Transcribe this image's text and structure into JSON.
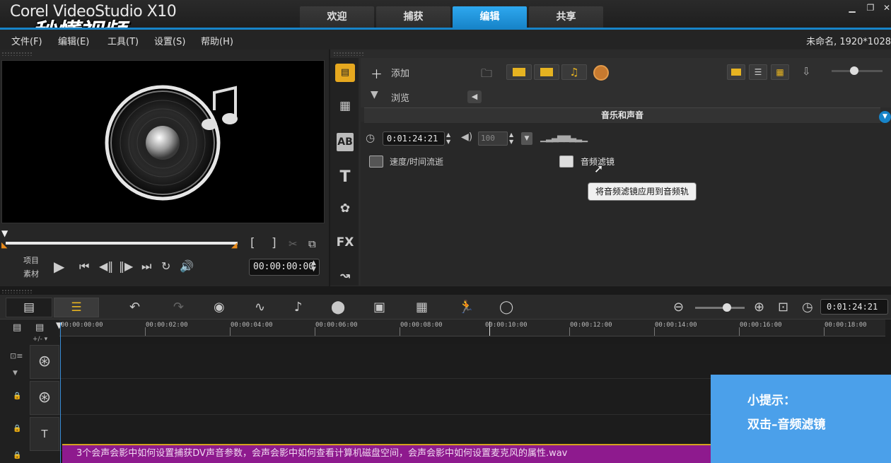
{
  "window": {
    "app_title": "Corel VideoStudio X10",
    "watermark": "秒懂视频",
    "tabs": [
      {
        "label": "欢迎"
      },
      {
        "label": "捕获"
      },
      {
        "label": "编辑",
        "active": true
      },
      {
        "label": "共享"
      }
    ],
    "controls": [
      "minimize-icon",
      "restore-icon",
      "close-icon"
    ]
  },
  "menu": {
    "items": [
      "文件(F)",
      "编辑(E)",
      "工具(T)",
      "设置(S)",
      "帮助(H)"
    ],
    "project_info": "未命名, 1920*1028"
  },
  "player": {
    "mode_project": "项目",
    "mode_clip": "素材",
    "timecode": "00:00:00:00",
    "mark_in": "[",
    "mark_out": "]"
  },
  "library": {
    "add_label": "添加",
    "browse_label": "浏览",
    "panel_title": "音乐和声音",
    "duration": "0:01:24:21",
    "volume": "100",
    "items": [
      {
        "label": "速度/时间流逝"
      },
      {
        "label": "音频滤镜"
      }
    ],
    "tooltip": "将音频滤镜应用到音频轨",
    "side_icons": [
      "media-icon",
      "instant-project-icon",
      "transition-icon",
      "title-icon",
      "graphic-icon",
      "fx-icon",
      "path-icon"
    ],
    "fx_label": "FX",
    "ab_label": "AB",
    "title_label": "T"
  },
  "timeline": {
    "timecode": "0:01:24:21",
    "ruler": [
      "00:00:00:00",
      "00:00:02:00",
      "00:00:04:00",
      "00:00:06:00",
      "00:00:08:00",
      "00:00:10:00",
      "00:00:12:00",
      "00:00:14:00",
      "00:00:16:00",
      "00:00:18:00"
    ],
    "title_track_label": "T",
    "title_clip": "3个会声会影中如何设置捕获DV声音参数，会声会影中如何查看计算机磁盘空间，会声会影中如何设置麦克风的属性.wav"
  },
  "hint": {
    "title": "小提示：",
    "body": "双击–音频滤镜"
  },
  "colors": {
    "accent": "#1784c9",
    "hint_bg": "#4ba0ea",
    "title_clip": "#8e1a8e"
  }
}
